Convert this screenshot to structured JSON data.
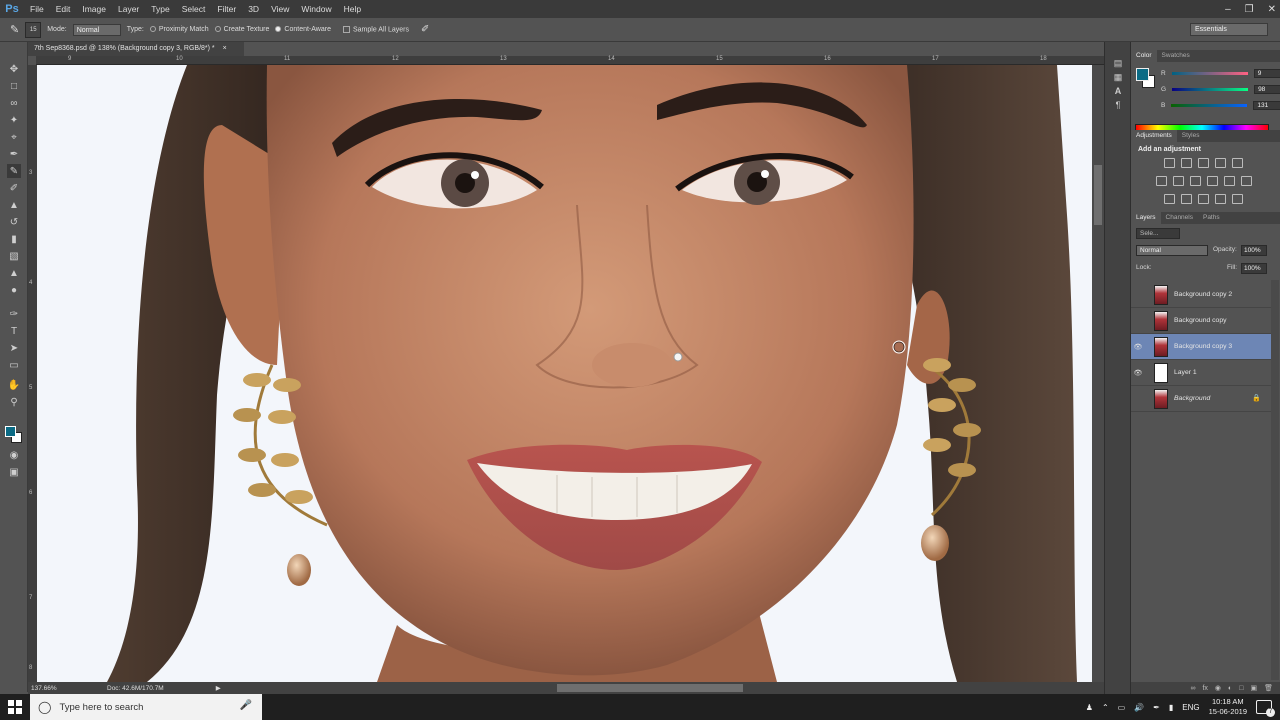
{
  "menubar": {
    "logo": "Ps",
    "items": [
      "File",
      "Edit",
      "Image",
      "Layer",
      "Type",
      "Select",
      "Filter",
      "3D",
      "View",
      "Window",
      "Help"
    ]
  },
  "options": {
    "brush_size": "15",
    "mode_label": "Mode:",
    "mode_value": "Normal",
    "type_label": "Type:",
    "proximity": "Proximity Match",
    "create_texture": "Create Texture",
    "content_aware": "Content-Aware",
    "sample_all": "Sample All Layers",
    "workspace": "Essentials"
  },
  "document": {
    "tab_title": "7th Sep8368.psd @ 138% (Background copy 3, RGB/8*) *",
    "zoom": "137.66%",
    "doc_size": "Doc: 42.6M/170.7M",
    "ruler_h": [
      "9",
      "10",
      "11",
      "12",
      "13",
      "14",
      "15",
      "16",
      "17",
      "18"
    ],
    "ruler_v": [
      "3",
      "4",
      "5",
      "6",
      "7",
      "8"
    ]
  },
  "color_panel": {
    "tabs": [
      "Color",
      "Swatches"
    ],
    "r_label": "R",
    "g_label": "G",
    "b_label": "B",
    "r": "9",
    "g": "98",
    "b": "131",
    "fg_color": "#0b6b85"
  },
  "adjustments": {
    "tabs": [
      "Adjustments",
      "Styles"
    ],
    "title": "Add an adjustment"
  },
  "layers": {
    "tabs": [
      "Layers",
      "Channels",
      "Paths"
    ],
    "search": "Sele...",
    "blend": "Normal",
    "opacity_label": "Opacity:",
    "opacity": "100%",
    "lock_label": "Lock:",
    "fill_label": "Fill:",
    "fill": "100%",
    "rows": [
      {
        "name": "Background copy 2",
        "visible": false,
        "selected": false,
        "thumb": "photo"
      },
      {
        "name": "Background copy",
        "visible": false,
        "selected": false,
        "thumb": "photo"
      },
      {
        "name": "Background copy 3",
        "visible": true,
        "selected": true,
        "thumb": "photo"
      },
      {
        "name": "Layer 1",
        "visible": true,
        "selected": false,
        "thumb": "white"
      },
      {
        "name": "Background",
        "visible": false,
        "selected": false,
        "thumb": "photo",
        "locked": true
      }
    ]
  },
  "taskbar": {
    "search_placeholder": "Type here to search",
    "lang": "ENG",
    "time": "10:18 AM",
    "date": "15-06-2019",
    "notifications": "7"
  }
}
